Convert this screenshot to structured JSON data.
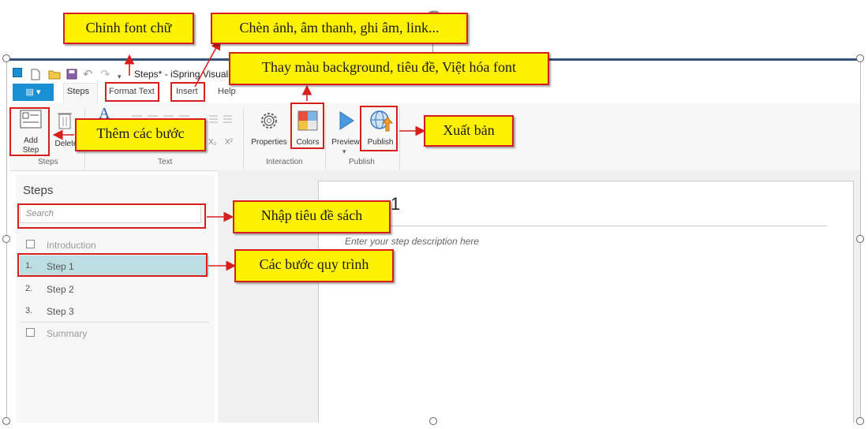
{
  "app": {
    "title": "Steps* - iSpring Visuals",
    "file_button": "▤ ▾",
    "tabs": [
      "Steps",
      "Format Text",
      "Insert",
      "Help"
    ],
    "ribbon": {
      "add_step": "Add Step",
      "delete": "Delete",
      "subscript": "X₂",
      "superscript": "X²",
      "properties": "Properties",
      "colors": "Colors",
      "preview": "Preview",
      "publish": "Publish",
      "groups": {
        "steps": "Steps",
        "text": "Text",
        "interaction": "Interaction",
        "publish": "Publish"
      }
    }
  },
  "sidebar": {
    "title": "Steps",
    "search_placeholder": "Search",
    "items": [
      {
        "num": "",
        "label": "Introduction"
      },
      {
        "num": "1.",
        "label": "Step 1"
      },
      {
        "num": "2.",
        "label": "Step 2"
      },
      {
        "num": "3.",
        "label": "Step 3"
      },
      {
        "num": "",
        "label": "Summary"
      }
    ]
  },
  "canvas": {
    "title_char": "1",
    "description_placeholder": "Enter your step description here"
  },
  "callouts": {
    "format_font": "Chỉnh font chữ",
    "insert_media": "Chèn ảnh, âm thanh, ghi âm, link...",
    "colors": "Thay màu background, tiêu đề, Việt hóa font",
    "add_steps": "Thêm các bước",
    "publish": "Xuất bản",
    "title_input": "Nhập tiêu đề sách",
    "process_steps": "Các bước quy trình"
  },
  "colors": {
    "accent": "#1a8fd1",
    "callout_fill": "#fff200",
    "callout_border": "#d81d1d",
    "selected_row": "#bcdde2"
  }
}
